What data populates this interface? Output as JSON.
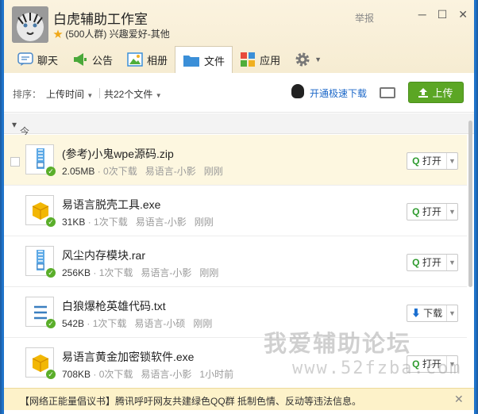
{
  "group": {
    "title": "白虎辅助工作室",
    "meta": "(500人群) 兴趣爱好-其他",
    "report": "举报"
  },
  "tabs": [
    {
      "label": "聊天",
      "icon": "chat-icon"
    },
    {
      "label": "公告",
      "icon": "announcement-icon"
    },
    {
      "label": "相册",
      "icon": "album-icon"
    },
    {
      "label": "文件",
      "icon": "folder-icon",
      "active": true
    },
    {
      "label": "应用",
      "icon": "apps-icon"
    }
  ],
  "toolbar": {
    "sort_label": "排序：",
    "sort_value": "上传时间",
    "count": "共22个文件",
    "fast_download": "开通极速下载",
    "upload": "上传"
  },
  "section": {
    "label": "今天"
  },
  "files": [
    {
      "name": "(参考)小鬼wpe源码.zip",
      "size": "2.05MB",
      "downloads": "0次下载",
      "uploader": "易语言-小影",
      "time": "刚刚",
      "action": "打开",
      "type": "zip"
    },
    {
      "name": "易语言脱壳工具.exe",
      "size": "31KB",
      "downloads": "1次下载",
      "uploader": "易语言-小影",
      "time": "刚刚",
      "action": "打开",
      "type": "exe"
    },
    {
      "name": "风尘内存模块.rar",
      "size": "256KB",
      "downloads": "1次下载",
      "uploader": "易语言-小影",
      "time": "刚刚",
      "action": "打开",
      "type": "zip"
    },
    {
      "name": "白狼爆枪英雄代码.txt",
      "size": "542B",
      "downloads": "1次下载",
      "uploader": "易语言-小硕",
      "time": "刚刚",
      "action": "下载",
      "type": "txt"
    },
    {
      "name": "易语言黄金加密锁软件.exe",
      "size": "708KB",
      "downloads": "0次下载",
      "uploader": "易语言-小影",
      "time": "1小时前",
      "action": "打开",
      "type": "exe"
    }
  ],
  "notice": "【网络正能量倡议书】腾讯呼吁网友共建绿色QQ群 抵制色情、反动等违法信息。",
  "watermark": {
    "line1": "我爱辅助论坛",
    "line2": "www.52fzba.com"
  },
  "colors": {
    "accent": "#5ba624",
    "link": "#1b67c8",
    "selected_row": "#fdf7e0"
  }
}
